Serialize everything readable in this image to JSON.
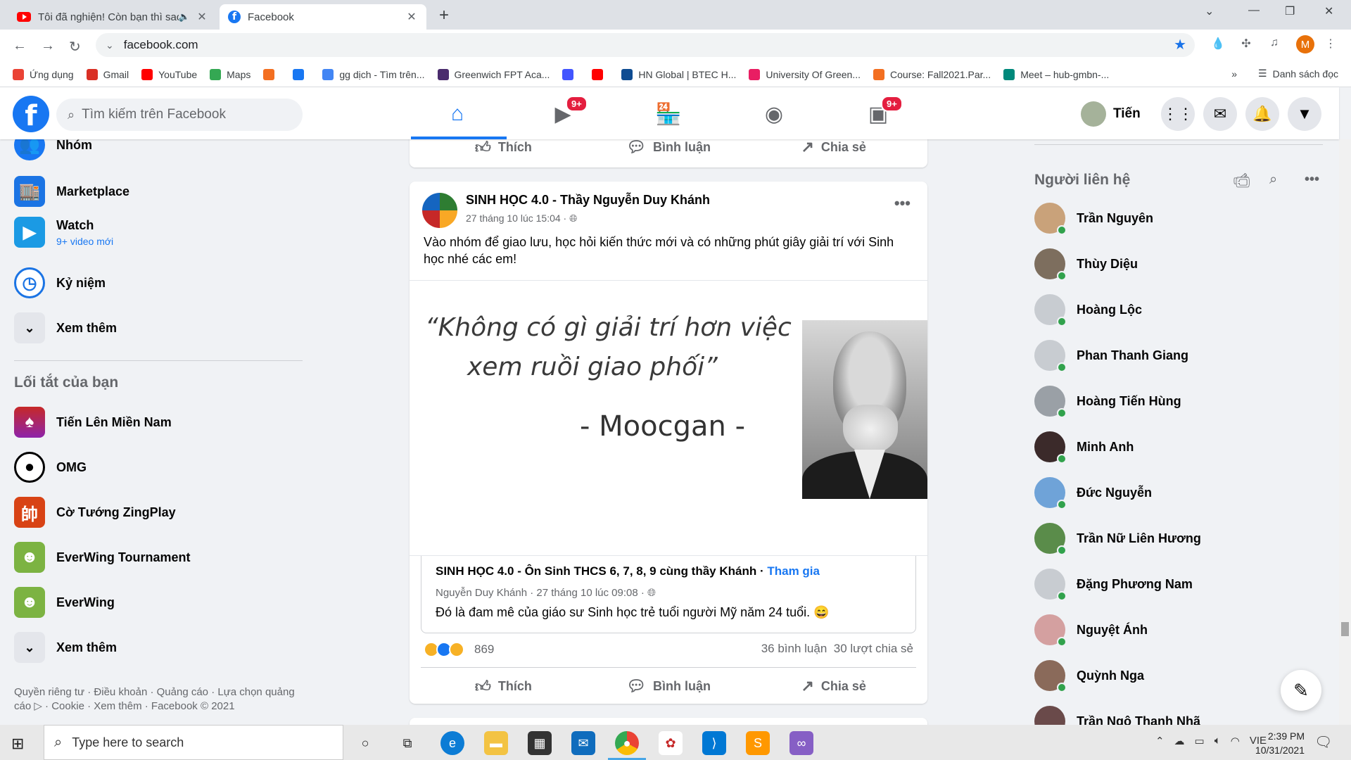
{
  "browser": {
    "tabs": [
      {
        "title": "Tôi đã nghiện! Còn bạn thì sao",
        "icon": "youtube-icon"
      },
      {
        "title": "Facebook",
        "icon": "facebook-icon"
      }
    ],
    "url": "facebook.com",
    "bookmarks": [
      {
        "label": "Ứng dụng",
        "icon": "apps-grid-icon",
        "color": "#ea4335"
      },
      {
        "label": "Gmail",
        "icon": "gmail-icon",
        "color": "#d93025"
      },
      {
        "label": "YouTube",
        "icon": "youtube-icon",
        "color": "#ff0000"
      },
      {
        "label": "Maps",
        "icon": "maps-icon",
        "color": "#34a853"
      },
      {
        "label": "",
        "icon": "fpt-icon",
        "color": "#f36f21"
      },
      {
        "label": "",
        "icon": "facebook-icon",
        "color": "#1877f2"
      },
      {
        "label": "gg dịch - Tìm trên...",
        "icon": "google-icon",
        "color": "#4285f4"
      },
      {
        "label": "Greenwich FPT Aca...",
        "icon": "greenwich-icon",
        "color": "#4a2c6d"
      },
      {
        "label": "",
        "icon": "quizlet-icon",
        "color": "#4255ff"
      },
      {
        "label": "",
        "icon": "youtube-icon",
        "color": "#ff0000"
      },
      {
        "label": "HN Global | BTEC H...",
        "icon": "pearson-icon",
        "color": "#0e4c92"
      },
      {
        "label": "University Of Green...",
        "icon": "university-icon",
        "color": "#e91e63"
      },
      {
        "label": "Course: Fall2021.Par...",
        "icon": "fpt-icon",
        "color": "#f36f21"
      },
      {
        "label": "Meet – hub-gmbn-...",
        "icon": "meet-icon",
        "color": "#00897b"
      }
    ],
    "reading_list": "Danh sách đọc",
    "profile_initial": "M"
  },
  "header": {
    "search_placeholder": "Tìm kiếm trên Facebook",
    "watch_badge": "9+",
    "gaming_badge": "9+",
    "profile_name": "Tiến"
  },
  "left": {
    "items": [
      {
        "label": "Nhóm"
      },
      {
        "label": "Marketplace"
      },
      {
        "label": "Watch",
        "sub": "9+ video mới"
      },
      {
        "label": "Kỷ niệm"
      },
      {
        "label": "Xem thêm"
      }
    ],
    "shortcuts_title": "Lối tắt của bạn",
    "shortcuts": [
      {
        "label": "Tiến Lên Miền Nam"
      },
      {
        "label": "OMG"
      },
      {
        "label": "Cờ Tướng ZingPlay"
      },
      {
        "label": "EverWing Tournament"
      },
      {
        "label": "EverWing"
      },
      {
        "label": "Xem thêm"
      }
    ],
    "footer": "Quyền riêng tư · Điều khoản · Quảng cáo · Lựa chọn quảng cáo ▷ · Cookie · Xem thêm · Facebook © 2021"
  },
  "feed": {
    "actions": {
      "like": "Thích",
      "comment": "Bình luận",
      "share": "Chia sẻ"
    },
    "post": {
      "author": "SINH HỌC 4.0 - Thầy Nguyễn Duy Khánh",
      "time": "27 tháng 10 lúc 15:04 ·",
      "text": "Vào nhóm để giao lưu, học hỏi kiến thức mới và có những phút giây giải trí với Sinh học nhé các em!",
      "image": {
        "quote_line1": "“Không có gì giải trí hơn việc",
        "quote_line2": "xem ruồi giao phối”",
        "author": "- Moocgan -"
      },
      "shared_group": {
        "name": "SINH HỌC 4.0 - Ôn Sinh THCS 6, 7, 8, 9 cùng thầy Khánh",
        "join": "Tham gia",
        "meta": "Nguyễn Duy Khánh · 27 tháng 10 lúc 09:08 ·",
        "text": "Đó là đam mê của giáo sư Sinh học trẻ tuổi người Mỹ năm 24 tuổi. 😄"
      },
      "reaction_count": "869",
      "comments": "36 bình luận",
      "shares": "30 lượt chia sẻ"
    }
  },
  "right": {
    "title": "Người liên hệ",
    "contacts": [
      {
        "name": "Trần Nguyên",
        "color": "#c9a27a"
      },
      {
        "name": "Thùy Diệu",
        "color": "#7d6e5e"
      },
      {
        "name": "Hoàng Lộc",
        "color": "#c8ccd1"
      },
      {
        "name": "Phan Thanh Giang",
        "color": "#c8ccd1"
      },
      {
        "name": "Hoàng Tiến Hùng",
        "color": "#9aa0a6"
      },
      {
        "name": "Minh Anh",
        "color": "#3b2a2a"
      },
      {
        "name": "Đức Nguyễn",
        "color": "#6fa3d8"
      },
      {
        "name": "Trần Nữ Liên Hương",
        "color": "#5a8c4a"
      },
      {
        "name": "Đặng Phương Nam",
        "color": "#c8ccd1"
      },
      {
        "name": "Nguyệt Ánh",
        "color": "#d4a0a0"
      },
      {
        "name": "Quỳnh Nga",
        "color": "#8a6a5a"
      },
      {
        "name": "Trần Ngô Thanh Nhã",
        "color": "#6a4a4a"
      }
    ]
  },
  "taskbar": {
    "search_placeholder": "Type here to search",
    "language": "VIE",
    "time": "2:39 PM",
    "date": "10/31/2021"
  }
}
